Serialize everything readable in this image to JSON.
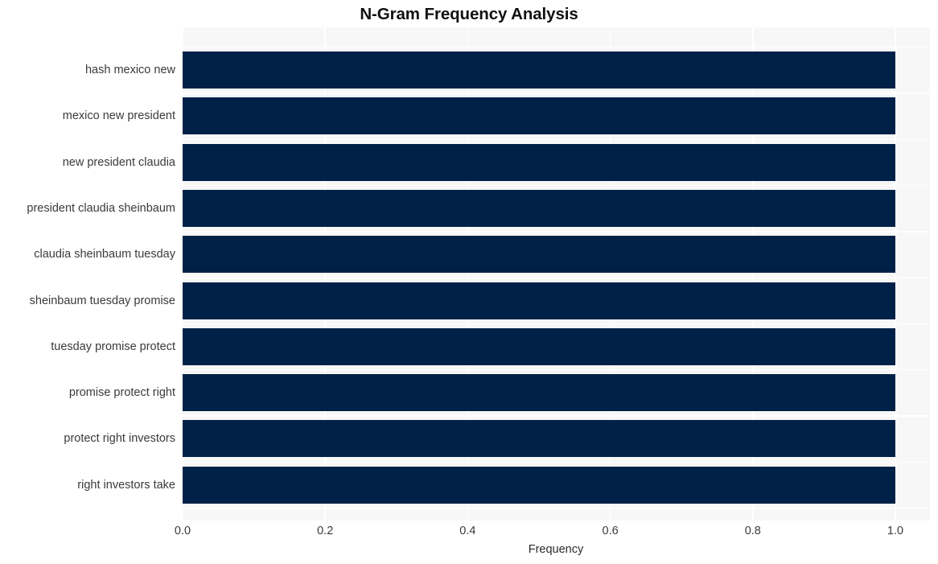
{
  "chart_data": {
    "type": "bar",
    "orientation": "horizontal",
    "title": "N-Gram Frequency Analysis",
    "xlabel": "Frequency",
    "ylabel": "",
    "categories": [
      "hash mexico new",
      "mexico new president",
      "new president claudia",
      "president claudia sheinbaum",
      "claudia sheinbaum tuesday",
      "sheinbaum tuesday promise",
      "tuesday promise protect",
      "promise protect right",
      "protect right investors",
      "right investors take"
    ],
    "values": [
      1.0,
      1.0,
      1.0,
      1.0,
      1.0,
      1.0,
      1.0,
      1.0,
      1.0,
      1.0
    ],
    "xlim": [
      0.0,
      1.0
    ],
    "xticks": [
      "0.0",
      "0.2",
      "0.4",
      "0.6",
      "0.8",
      "1.0"
    ],
    "xtick_values": [
      0.0,
      0.2,
      0.4,
      0.6,
      0.8,
      1.0
    ],
    "grid": true,
    "legend": null,
    "bar_color": "#002147",
    "plot_background": "#f7f7f7",
    "figure_background": "#ffffff",
    "gridline_color": "#ffffff",
    "tick_label_color": "#3a3a3a",
    "title_color": "#111111"
  }
}
